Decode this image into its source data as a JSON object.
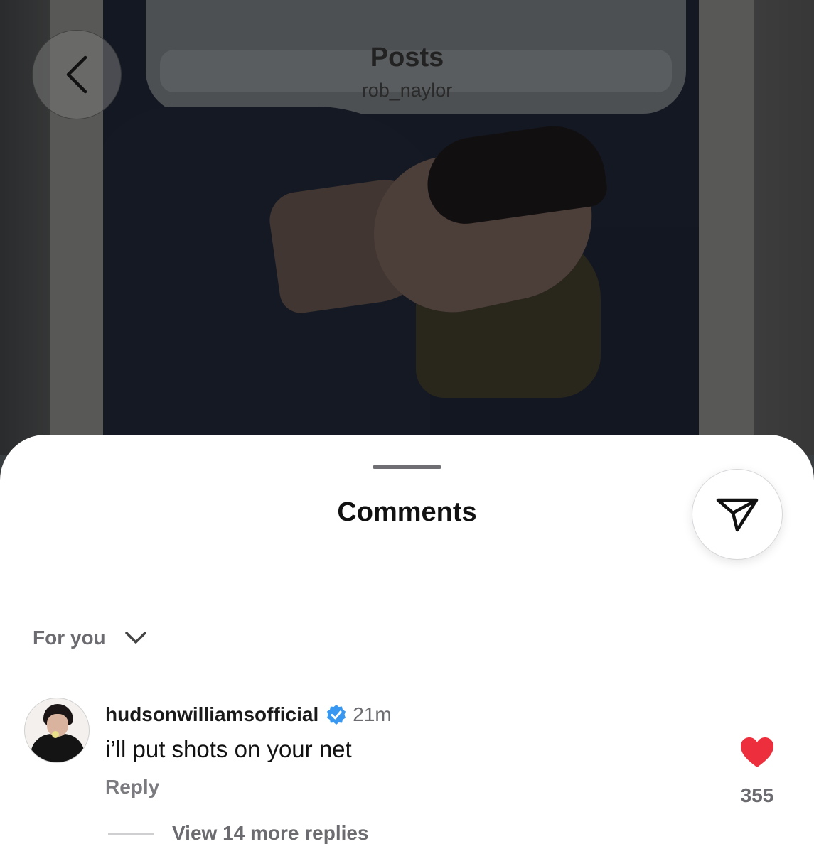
{
  "header": {
    "title": "Posts",
    "username": "rob_naylor"
  },
  "sheet": {
    "title": "Comments"
  },
  "sort": {
    "label": "For you"
  },
  "comment": {
    "username": "hudsonwilliamsofficial",
    "time": "21m",
    "text": "i’ll put shots on your net",
    "reply_label": "Reply",
    "likes": "355",
    "view_replies": "View 14 more replies"
  },
  "colors": {
    "like_heart": "#ed2f3d",
    "verified_badge": "#3897f0"
  }
}
